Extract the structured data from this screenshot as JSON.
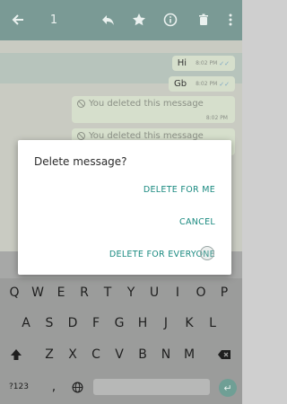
{
  "app_bar": {
    "selected_count": "1",
    "icons": [
      "back-arrow-icon",
      "reply-icon",
      "star-icon",
      "info-icon",
      "delete-icon",
      "more-icon"
    ]
  },
  "chat": {
    "messages": [
      {
        "text": "Hi",
        "time": "8:02 PM"
      },
      {
        "text": "Gb",
        "time": "8:02 PM"
      }
    ],
    "deleted_messages": [
      {
        "text": "You deleted this message",
        "time": "8:02 PM"
      },
      {
        "text": "You deleted this message",
        "time": ""
      }
    ]
  },
  "dialog": {
    "title": "Delete message?",
    "delete_for_me": "DELETE FOR ME",
    "cancel": "CANCEL",
    "delete_for_everyone": "DELETE FOR EVERYONE"
  },
  "keyboard": {
    "row1": [
      "Q",
      "W",
      "E",
      "R",
      "T",
      "Y",
      "U",
      "I",
      "O",
      "P"
    ],
    "row2": [
      "A",
      "S",
      "D",
      "F",
      "G",
      "H",
      "J",
      "K",
      "L"
    ],
    "row3": [
      "Z",
      "X",
      "C",
      "V",
      "B",
      "N",
      "M"
    ],
    "symbols_key": "?123",
    "comma_key": ",",
    "period_key": "."
  },
  "colors": {
    "accent": "#1a8a80",
    "app_bar_dimmed": "#7a9a95"
  }
}
